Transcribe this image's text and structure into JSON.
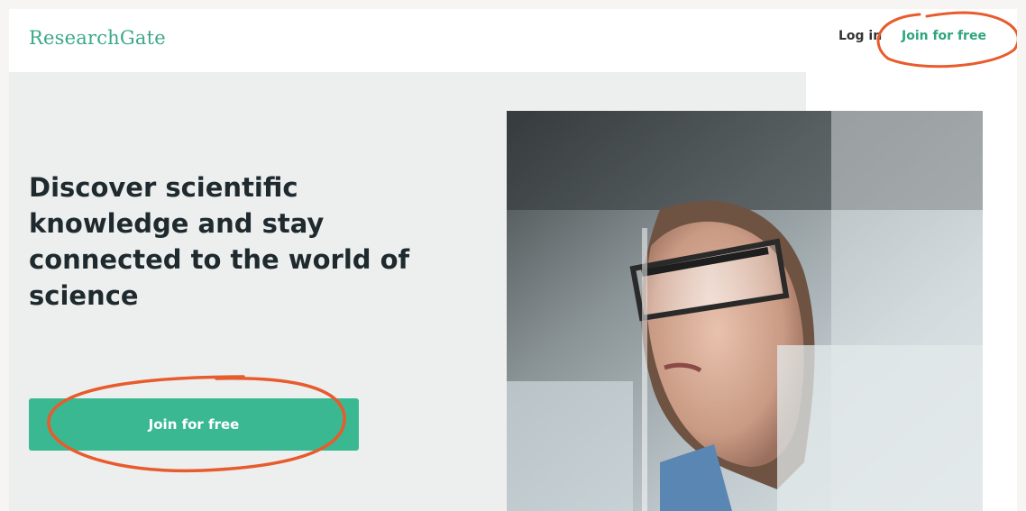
{
  "header": {
    "logo": "ResearchGate",
    "login_label": "Log in",
    "join_label": "Join for free"
  },
  "hero": {
    "headline": "Discover scientific knowledge and stay connected to the world of science",
    "cta_label": "Join for free",
    "image_alt": "Scientist wearing safety glasses in a laboratory"
  },
  "colors": {
    "brand": "#3aa88a",
    "cta_background": "#3ab892",
    "hero_background": "#ecefee",
    "annotation": "#e85b2c"
  }
}
